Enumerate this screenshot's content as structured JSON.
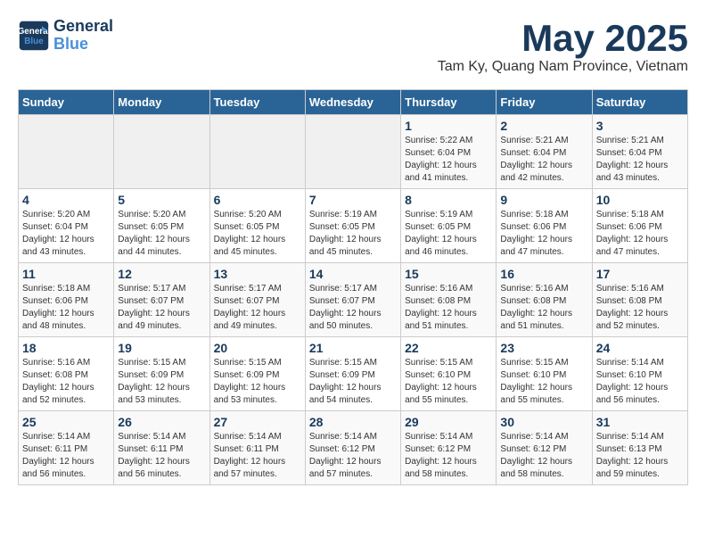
{
  "header": {
    "logo_line1": "General",
    "logo_line2": "Blue",
    "month": "May 2025",
    "location": "Tam Ky, Quang Nam Province, Vietnam"
  },
  "weekdays": [
    "Sunday",
    "Monday",
    "Tuesday",
    "Wednesday",
    "Thursday",
    "Friday",
    "Saturday"
  ],
  "weeks": [
    [
      {
        "day": "",
        "info": ""
      },
      {
        "day": "",
        "info": ""
      },
      {
        "day": "",
        "info": ""
      },
      {
        "day": "",
        "info": ""
      },
      {
        "day": "1",
        "info": "Sunrise: 5:22 AM\nSunset: 6:04 PM\nDaylight: 12 hours\nand 41 minutes."
      },
      {
        "day": "2",
        "info": "Sunrise: 5:21 AM\nSunset: 6:04 PM\nDaylight: 12 hours\nand 42 minutes."
      },
      {
        "day": "3",
        "info": "Sunrise: 5:21 AM\nSunset: 6:04 PM\nDaylight: 12 hours\nand 43 minutes."
      }
    ],
    [
      {
        "day": "4",
        "info": "Sunrise: 5:20 AM\nSunset: 6:04 PM\nDaylight: 12 hours\nand 43 minutes."
      },
      {
        "day": "5",
        "info": "Sunrise: 5:20 AM\nSunset: 6:05 PM\nDaylight: 12 hours\nand 44 minutes."
      },
      {
        "day": "6",
        "info": "Sunrise: 5:20 AM\nSunset: 6:05 PM\nDaylight: 12 hours\nand 45 minutes."
      },
      {
        "day": "7",
        "info": "Sunrise: 5:19 AM\nSunset: 6:05 PM\nDaylight: 12 hours\nand 45 minutes."
      },
      {
        "day": "8",
        "info": "Sunrise: 5:19 AM\nSunset: 6:05 PM\nDaylight: 12 hours\nand 46 minutes."
      },
      {
        "day": "9",
        "info": "Sunrise: 5:18 AM\nSunset: 6:06 PM\nDaylight: 12 hours\nand 47 minutes."
      },
      {
        "day": "10",
        "info": "Sunrise: 5:18 AM\nSunset: 6:06 PM\nDaylight: 12 hours\nand 47 minutes."
      }
    ],
    [
      {
        "day": "11",
        "info": "Sunrise: 5:18 AM\nSunset: 6:06 PM\nDaylight: 12 hours\nand 48 minutes."
      },
      {
        "day": "12",
        "info": "Sunrise: 5:17 AM\nSunset: 6:07 PM\nDaylight: 12 hours\nand 49 minutes."
      },
      {
        "day": "13",
        "info": "Sunrise: 5:17 AM\nSunset: 6:07 PM\nDaylight: 12 hours\nand 49 minutes."
      },
      {
        "day": "14",
        "info": "Sunrise: 5:17 AM\nSunset: 6:07 PM\nDaylight: 12 hours\nand 50 minutes."
      },
      {
        "day": "15",
        "info": "Sunrise: 5:16 AM\nSunset: 6:08 PM\nDaylight: 12 hours\nand 51 minutes."
      },
      {
        "day": "16",
        "info": "Sunrise: 5:16 AM\nSunset: 6:08 PM\nDaylight: 12 hours\nand 51 minutes."
      },
      {
        "day": "17",
        "info": "Sunrise: 5:16 AM\nSunset: 6:08 PM\nDaylight: 12 hours\nand 52 minutes."
      }
    ],
    [
      {
        "day": "18",
        "info": "Sunrise: 5:16 AM\nSunset: 6:08 PM\nDaylight: 12 hours\nand 52 minutes."
      },
      {
        "day": "19",
        "info": "Sunrise: 5:15 AM\nSunset: 6:09 PM\nDaylight: 12 hours\nand 53 minutes."
      },
      {
        "day": "20",
        "info": "Sunrise: 5:15 AM\nSunset: 6:09 PM\nDaylight: 12 hours\nand 53 minutes."
      },
      {
        "day": "21",
        "info": "Sunrise: 5:15 AM\nSunset: 6:09 PM\nDaylight: 12 hours\nand 54 minutes."
      },
      {
        "day": "22",
        "info": "Sunrise: 5:15 AM\nSunset: 6:10 PM\nDaylight: 12 hours\nand 55 minutes."
      },
      {
        "day": "23",
        "info": "Sunrise: 5:15 AM\nSunset: 6:10 PM\nDaylight: 12 hours\nand 55 minutes."
      },
      {
        "day": "24",
        "info": "Sunrise: 5:14 AM\nSunset: 6:10 PM\nDaylight: 12 hours\nand 56 minutes."
      }
    ],
    [
      {
        "day": "25",
        "info": "Sunrise: 5:14 AM\nSunset: 6:11 PM\nDaylight: 12 hours\nand 56 minutes."
      },
      {
        "day": "26",
        "info": "Sunrise: 5:14 AM\nSunset: 6:11 PM\nDaylight: 12 hours\nand 56 minutes."
      },
      {
        "day": "27",
        "info": "Sunrise: 5:14 AM\nSunset: 6:11 PM\nDaylight: 12 hours\nand 57 minutes."
      },
      {
        "day": "28",
        "info": "Sunrise: 5:14 AM\nSunset: 6:12 PM\nDaylight: 12 hours\nand 57 minutes."
      },
      {
        "day": "29",
        "info": "Sunrise: 5:14 AM\nSunset: 6:12 PM\nDaylight: 12 hours\nand 58 minutes."
      },
      {
        "day": "30",
        "info": "Sunrise: 5:14 AM\nSunset: 6:12 PM\nDaylight: 12 hours\nand 58 minutes."
      },
      {
        "day": "31",
        "info": "Sunrise: 5:14 AM\nSunset: 6:13 PM\nDaylight: 12 hours\nand 59 minutes."
      }
    ]
  ]
}
